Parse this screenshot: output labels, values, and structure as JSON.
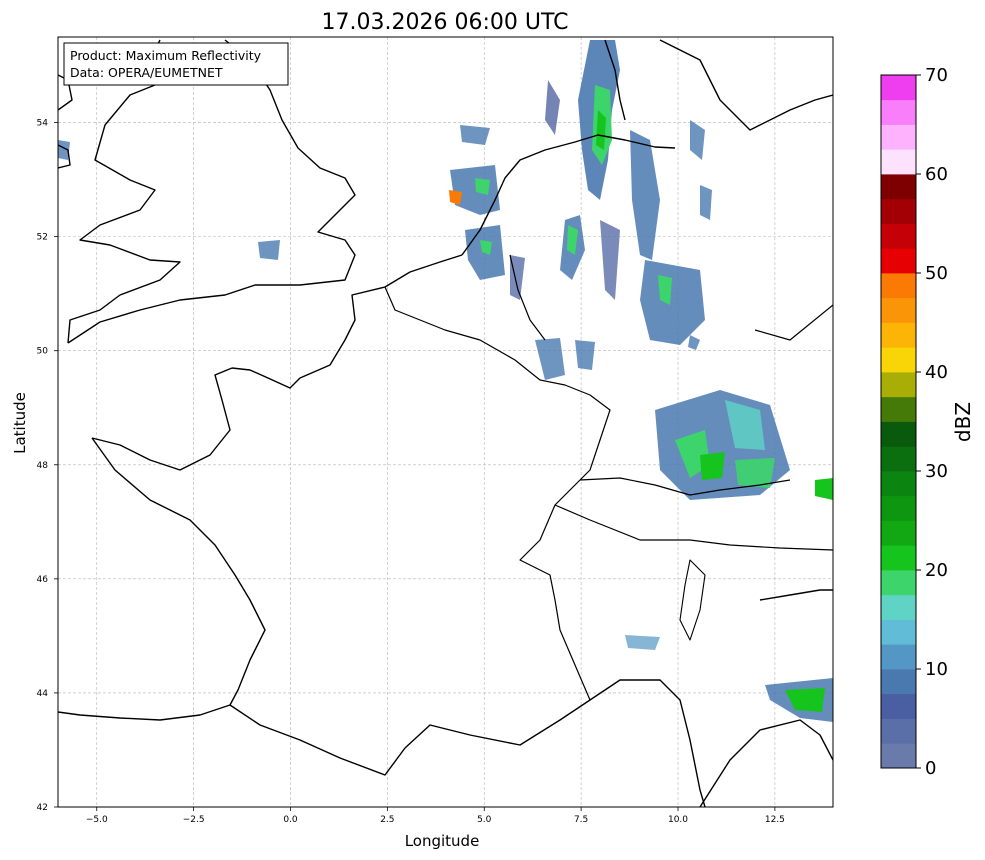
{
  "map": {
    "title": "17.03.2026 06:00 UTC",
    "info_box": {
      "line1": "Product: Maximum Reflectivity",
      "line2": "Data: OPERA/EUMETNET"
    },
    "x_axis_label": "Longitude",
    "y_axis_label": "Latitude",
    "extent": {
      "lon_min": -6,
      "lon_max": 14,
      "lat_min": 42,
      "lat_max": 55.5
    },
    "x_ticks": [
      "−5.0",
      "−2.5",
      "0.0",
      "2.5",
      "5.0",
      "7.5",
      "10.0",
      "12.5"
    ],
    "x_tick_values": [
      -5.0,
      -2.5,
      0.0,
      2.5,
      5.0,
      7.5,
      10.0,
      12.5
    ],
    "y_ticks": [
      "42",
      "44",
      "46",
      "48",
      "50",
      "52",
      "54"
    ],
    "y_tick_values": [
      42,
      44,
      46,
      48,
      50,
      52,
      54
    ],
    "grid": "dashed"
  },
  "colorbar": {
    "label": "dBZ",
    "tick_labels": [
      "0",
      "10",
      "20",
      "30",
      "40",
      "50",
      "60",
      "70"
    ],
    "tick_values": [
      0,
      10,
      20,
      30,
      40,
      50,
      60,
      70
    ],
    "vmin": 0,
    "vmax": 70,
    "colors": [
      "#6a7aab",
      "#5a6ea8",
      "#4a5fa2",
      "#4a79b0",
      "#5496c4",
      "#61bcd8",
      "#5fd4c4",
      "#3dd46b",
      "#16c41e",
      "#12a813",
      "#0f9610",
      "#0c8410",
      "#0b6e0f",
      "#095a0c",
      "#467a08",
      "#a8ae06",
      "#f9d507",
      "#fcb406",
      "#f99506",
      "#fa7a05",
      "#e60004",
      "#c50006",
      "#a20005",
      "#7f0000",
      "#fde2ff",
      "#fcb2fc",
      "#f97ef9",
      "#ee3ef0"
    ]
  }
}
